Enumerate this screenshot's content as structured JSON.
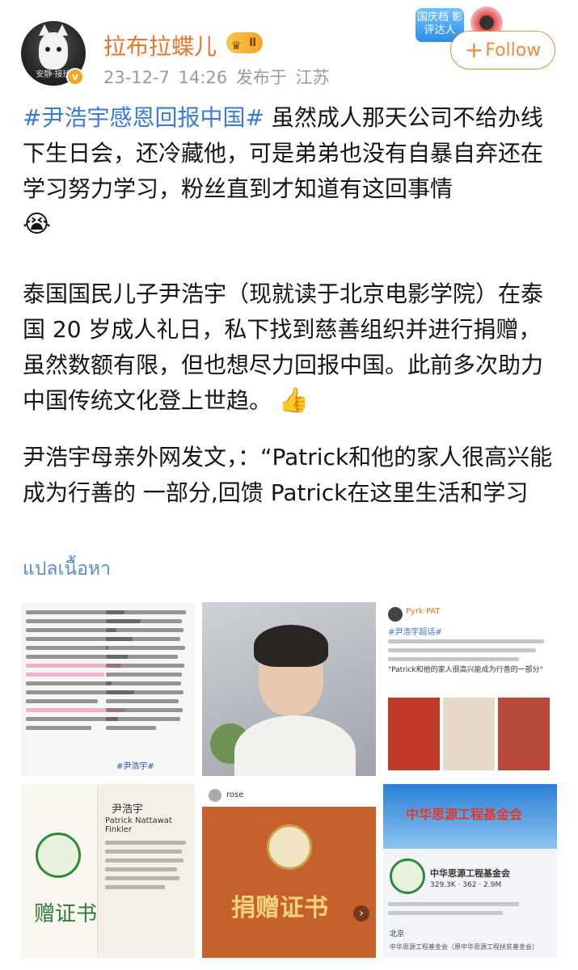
{
  "header": {
    "username": "拉布拉蝶儿",
    "level": "Ⅱ",
    "avatar_caption": "安静·接班",
    "verified_badge": "v",
    "date": "23-12-7 14:26",
    "published_at": "发布于 江苏",
    "honor_label": "国庆档 影评达人",
    "follow_label": "Follow"
  },
  "post": {
    "hashtag": "#尹浩宇感恩回报中国#",
    "p1_text": " 虽然成人那天公司不给办线下生日会，还冷藏他，可是弟弟也没有自暴自弃还在学习努力学习，粉丝直到才知道有这回事情",
    "p1_emoji": "😭",
    "p2_text": "泰国国民儿子尹浩宇（现就读于北京电影学院）在泰国 20 岁成人礼日，私下找到慈善组织并进行捐赠，虽然数额有限，但也想尽力回报中国。此前多次助力中国传统文化登上世趋。",
    "p2_emoji": "👍",
    "p3_text": "尹浩宇母亲外网发文，：“Patrick和他的家人很高兴能成为行善的 一部分,回馈 Patrick在这里生活和学习",
    "translate_label": "แปลเนื้อหา"
  },
  "images": {
    "t1_caption": "#尹浩宇#",
    "t3_user": "Pyrk·PAT",
    "t3_hashtag": "#尹浩宇超话#",
    "t3_quote": "\"Patrick和他的家人很高兴能成为行善的一部分\"",
    "t4_name": "尹浩宇",
    "t4_name_en": "Patrick Nattawat Finkler",
    "t4_cert": "赠证书",
    "t5_user": "rose",
    "t5_cert": "捐赠证书",
    "t6_banner": "中华思源工程基金会",
    "t6_name": "中华思源工程基金会",
    "t6_followers": "329.3K",
    "t6_following": "362",
    "t6_interaction": "2.9M",
    "t6_location": "北京",
    "t6_footer": "中华思源工程基金会（原中华思源工程扶贫基金会）"
  },
  "colors": {
    "username": "#e8762b",
    "hashtag": "#3a7bd5",
    "follow": "#f08a3e",
    "translate": "#5b8bcc"
  }
}
